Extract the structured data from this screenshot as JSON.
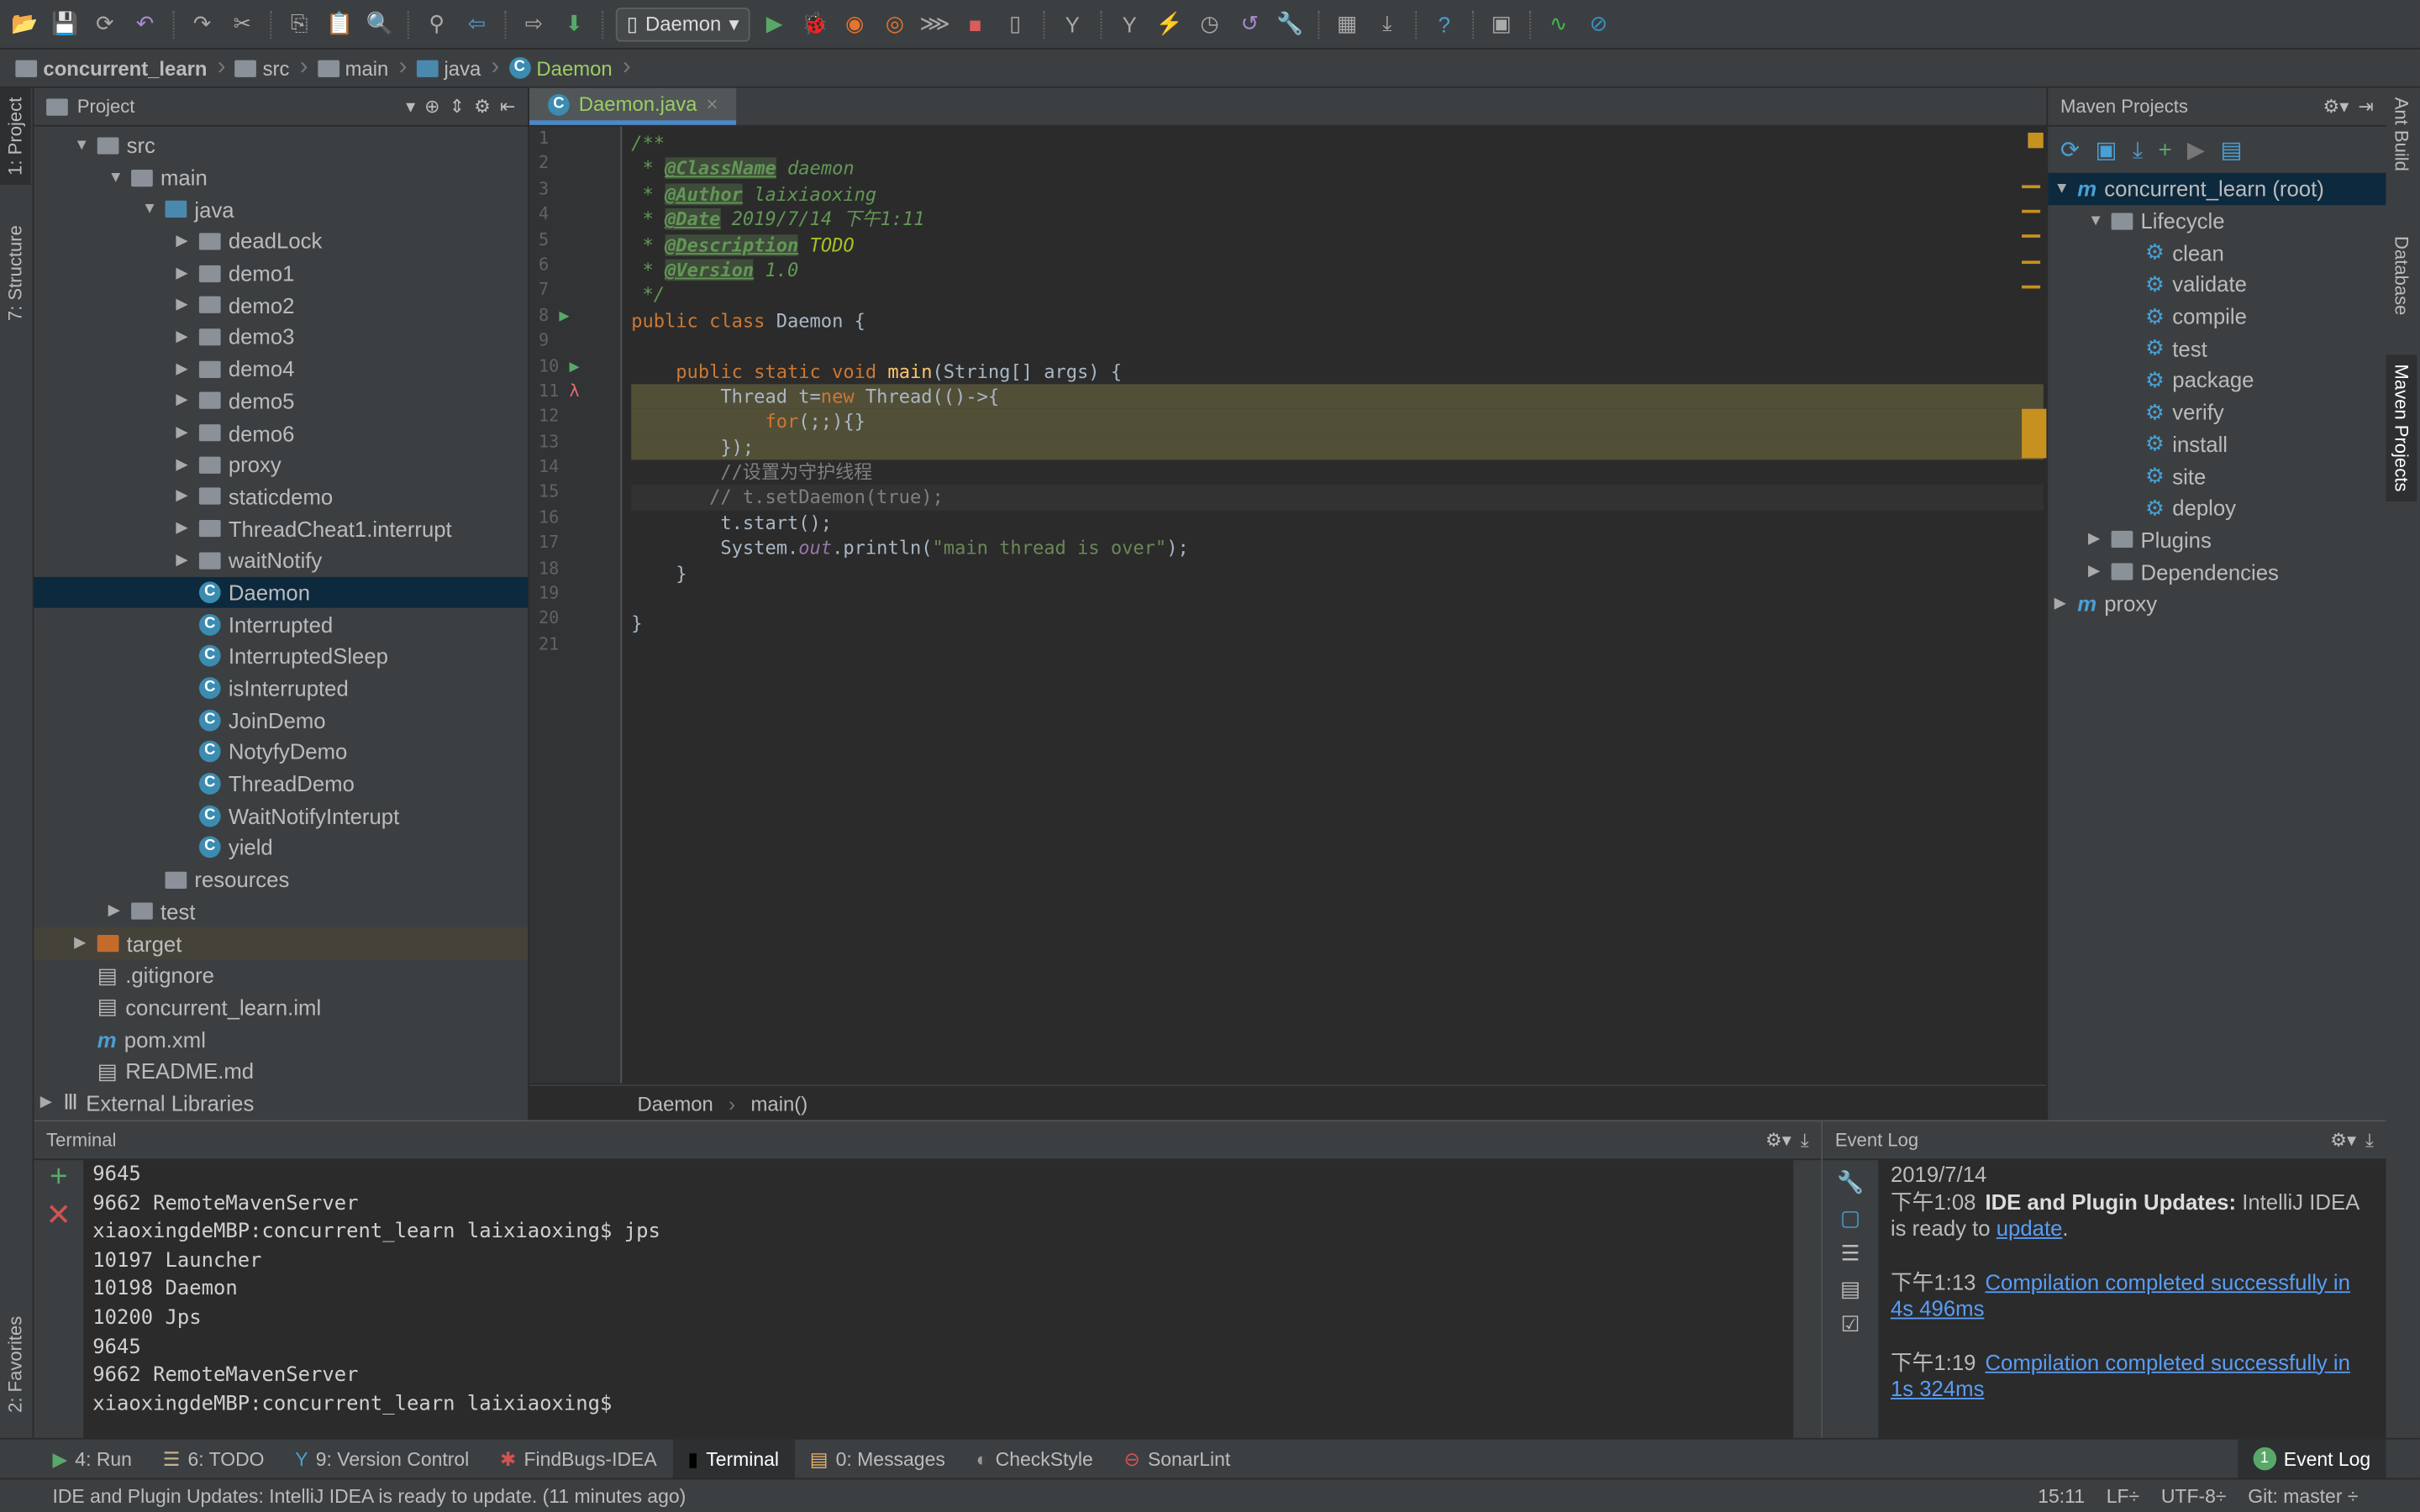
{
  "toolbar": {
    "run_config": "Daemon",
    "icons": [
      "open-icon",
      "save-icon",
      "sync-icon",
      "undo-icon",
      "redo-icon",
      "cut-icon",
      "copy-icon",
      "paste-icon",
      "find-icon",
      "replace-icon",
      "back-icon",
      "forward-icon",
      "build-icon",
      "run-icon",
      "debug-icon",
      "coverage-icon",
      "profile-icon",
      "concurrency-icon",
      "stop-icon",
      "attach-icon",
      "vcs-update-icon",
      "vcs-commit-icon",
      "vcs-compare-icon",
      "vcs-history-icon",
      "vcs-revert-icon",
      "settings-icon",
      "structure-icon",
      "sdk-icon",
      "help-icon",
      "android-icon",
      "activity-icon",
      "block-icon"
    ]
  },
  "breadcrumb": [
    "concurrent_learn",
    "src",
    "main",
    "java",
    "Daemon"
  ],
  "left_strip": [
    "1: Project",
    "7: Structure",
    "2: Favorites"
  ],
  "right_strip": [
    "Ant Build",
    "Database",
    "Maven Projects"
  ],
  "project": {
    "title": "Project",
    "tree": [
      {
        "label": "src",
        "depth": 1,
        "type": "folder",
        "open": true
      },
      {
        "label": "main",
        "depth": 2,
        "type": "folder",
        "open": true
      },
      {
        "label": "java",
        "depth": 3,
        "type": "folder-blue",
        "open": true
      },
      {
        "label": "deadLock",
        "depth": 4,
        "type": "package",
        "open": false
      },
      {
        "label": "demo1",
        "depth": 4,
        "type": "package",
        "open": false
      },
      {
        "label": "demo2",
        "depth": 4,
        "type": "package",
        "open": false
      },
      {
        "label": "demo3",
        "depth": 4,
        "type": "package",
        "open": false
      },
      {
        "label": "demo4",
        "depth": 4,
        "type": "package",
        "open": false
      },
      {
        "label": "demo5",
        "depth": 4,
        "type": "package",
        "open": false
      },
      {
        "label": "demo6",
        "depth": 4,
        "type": "package",
        "open": false
      },
      {
        "label": "proxy",
        "depth": 4,
        "type": "package",
        "open": false
      },
      {
        "label": "staticdemo",
        "depth": 4,
        "type": "package",
        "open": false
      },
      {
        "label": "ThreadCheat1.interrupt",
        "depth": 4,
        "type": "package",
        "open": false
      },
      {
        "label": "waitNotify",
        "depth": 4,
        "type": "package",
        "open": false
      },
      {
        "label": "Daemon",
        "depth": 4,
        "type": "class",
        "selected": true
      },
      {
        "label": "Interrupted",
        "depth": 4,
        "type": "class"
      },
      {
        "label": "InterruptedSleep",
        "depth": 4,
        "type": "class"
      },
      {
        "label": "isInterrupted",
        "depth": 4,
        "type": "class"
      },
      {
        "label": "JoinDemo",
        "depth": 4,
        "type": "class"
      },
      {
        "label": "NotyfyDemo",
        "depth": 4,
        "type": "class"
      },
      {
        "label": "ThreadDemo",
        "depth": 4,
        "type": "class"
      },
      {
        "label": "WaitNotifyInterupt",
        "depth": 4,
        "type": "class"
      },
      {
        "label": "yield",
        "depth": 4,
        "type": "class"
      },
      {
        "label": "resources",
        "depth": 3,
        "type": "folder"
      },
      {
        "label": "test",
        "depth": 2,
        "type": "folder",
        "open": false
      },
      {
        "label": "target",
        "depth": 1,
        "type": "folder-orange",
        "open": false,
        "highlight": true
      },
      {
        "label": ".gitignore",
        "depth": 1,
        "type": "file"
      },
      {
        "label": "concurrent_learn.iml",
        "depth": 1,
        "type": "file"
      },
      {
        "label": "pom.xml",
        "depth": 1,
        "type": "maven"
      },
      {
        "label": "README.md",
        "depth": 1,
        "type": "file"
      },
      {
        "label": "External Libraries",
        "depth": 0,
        "type": "lib",
        "open": false
      }
    ]
  },
  "editor": {
    "tab": "Daemon.java",
    "footer": [
      "Daemon",
      "main()"
    ],
    "lines": [
      [
        [
          "doc",
          "/**"
        ]
      ],
      [
        [
          "doc",
          " * "
        ],
        [
          "tag",
          "@ClassName"
        ],
        [
          "doc",
          " daemon"
        ]
      ],
      [
        [
          "doc",
          " * "
        ],
        [
          "tag",
          "@Author"
        ],
        [
          "doc",
          " laixiaoxing"
        ]
      ],
      [
        [
          "doc",
          " * "
        ],
        [
          "tag",
          "@Date"
        ],
        [
          "doc",
          " 2019/7/14 下午1:11"
        ]
      ],
      [
        [
          "doc",
          " * "
        ],
        [
          "tag",
          "@Description"
        ],
        [
          "todo",
          " TODO"
        ]
      ],
      [
        [
          "doc",
          " * "
        ],
        [
          "tag",
          "@Version"
        ],
        [
          "doc",
          " 1.0"
        ]
      ],
      [
        [
          "doc",
          " */"
        ]
      ],
      [
        [
          "kw",
          "public class "
        ],
        [
          "",
          "Daemon {"
        ]
      ],
      [
        [
          "",
          ""
        ]
      ],
      [
        [
          "kw",
          "    public static void "
        ],
        [
          "fn",
          "main"
        ],
        [
          "",
          "(String[] args) {"
        ]
      ],
      [
        [
          "",
          "        Thread t="
        ],
        [
          "kw",
          "new "
        ],
        [
          "",
          "Thread(()->{"
        ]
      ],
      [
        [
          "kw",
          "            for"
        ],
        [
          "",
          "(;;){}"
        ]
      ],
      [
        [
          "",
          "        });"
        ]
      ],
      [
        [
          "cmt",
          "        //设置为守护线程"
        ]
      ],
      [
        [
          "cmt",
          "       // t.setDaemon(true);"
        ]
      ],
      [
        [
          "",
          "        t.start();"
        ]
      ],
      [
        [
          "",
          "        System."
        ],
        [
          "fld",
          "out"
        ],
        [
          "",
          ".println("
        ],
        [
          "str",
          "\"main thread is over\""
        ],
        [
          "",
          ");"
        ]
      ],
      [
        [
          "",
          "    }"
        ]
      ],
      [
        [
          "",
          ""
        ]
      ],
      [
        [
          "",
          "}"
        ]
      ],
      [
        [
          "",
          ""
        ]
      ]
    ]
  },
  "maven": {
    "title": "Maven Projects",
    "tree": [
      {
        "label": "concurrent_learn (root)",
        "depth": 0,
        "type": "maven",
        "open": true,
        "selected": true
      },
      {
        "label": "Lifecycle",
        "depth": 1,
        "type": "folder",
        "open": true
      },
      {
        "label": "clean",
        "depth": 2,
        "type": "goal"
      },
      {
        "label": "validate",
        "depth": 2,
        "type": "goal"
      },
      {
        "label": "compile",
        "depth": 2,
        "type": "goal"
      },
      {
        "label": "test",
        "depth": 2,
        "type": "goal"
      },
      {
        "label": "package",
        "depth": 2,
        "type": "goal"
      },
      {
        "label": "verify",
        "depth": 2,
        "type": "goal"
      },
      {
        "label": "install",
        "depth": 2,
        "type": "goal"
      },
      {
        "label": "site",
        "depth": 2,
        "type": "goal"
      },
      {
        "label": "deploy",
        "depth": 2,
        "type": "goal"
      },
      {
        "label": "Plugins",
        "depth": 1,
        "type": "folder",
        "open": false
      },
      {
        "label": "Dependencies",
        "depth": 1,
        "type": "folder",
        "open": false
      },
      {
        "label": "proxy",
        "depth": 0,
        "type": "maven",
        "open": false
      }
    ]
  },
  "terminal": {
    "title": "Terminal",
    "lines": [
      "9645",
      "9662 RemoteMavenServer",
      "xiaoxingdeMBP:concurrent_learn laixiaoxing$ jps",
      "10197 Launcher",
      "10198 Daemon",
      "10200 Jps",
      "9645",
      "9662 RemoteMavenServer",
      "xiaoxingdeMBP:concurrent_learn laixiaoxing$ "
    ]
  },
  "event_log": {
    "title": "Event Log",
    "date": "2019/7/14",
    "entries": [
      {
        "time": "下午1:08",
        "bold": "IDE and Plugin Updates:",
        "text": " IntelliJ IDEA is ready to ",
        "link": "update",
        "after": "."
      },
      {
        "time": "下午1:13",
        "link": "Compilation completed successfully in 4s 496ms"
      },
      {
        "time": "下午1:19",
        "link": "Compilation completed successfully in 1s 324ms"
      }
    ]
  },
  "tool_windows": [
    {
      "label": "4: Run",
      "icon": "run-icon"
    },
    {
      "label": "6: TODO",
      "icon": "todo-icon"
    },
    {
      "label": "9: Version Control",
      "icon": "vcs-icon"
    },
    {
      "label": "FindBugs-IDEA",
      "icon": "bug-icon"
    },
    {
      "label": "Terminal",
      "icon": "terminal-icon",
      "active": true
    },
    {
      "label": "0: Messages",
      "icon": "messages-icon"
    },
    {
      "label": "CheckStyle",
      "icon": "checkstyle-icon"
    },
    {
      "label": "SonarLint",
      "icon": "sonarlint-icon"
    }
  ],
  "event_log_button": {
    "label": "Event Log",
    "count": "1"
  },
  "status": {
    "message": "IDE and Plugin Updates: IntelliJ IDEA is ready to update. (11 minutes ago)",
    "position": "15:11",
    "line_sep": "LF÷",
    "encoding": "UTF-8÷",
    "vcs": "Git: master ÷"
  }
}
